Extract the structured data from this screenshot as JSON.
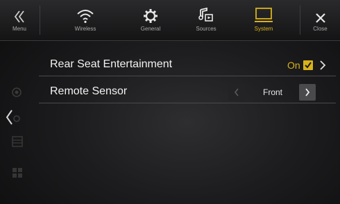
{
  "topbar": {
    "menu_label": "Menu",
    "tabs": [
      {
        "label": "Wireless",
        "icon": "wifi-icon"
      },
      {
        "label": "General",
        "icon": "gear-icon"
      },
      {
        "label": "Sources",
        "icon": "music-source-icon"
      },
      {
        "label": "System",
        "icon": "monitor-icon"
      }
    ],
    "close_label": "Close",
    "active_tab": "System",
    "active_color": "#d9b21a"
  },
  "settings": {
    "rear_seat": {
      "label": "Rear Seat Entertainment",
      "value": "On"
    },
    "remote_sensor": {
      "label": "Remote Sensor",
      "value": "Front"
    }
  }
}
